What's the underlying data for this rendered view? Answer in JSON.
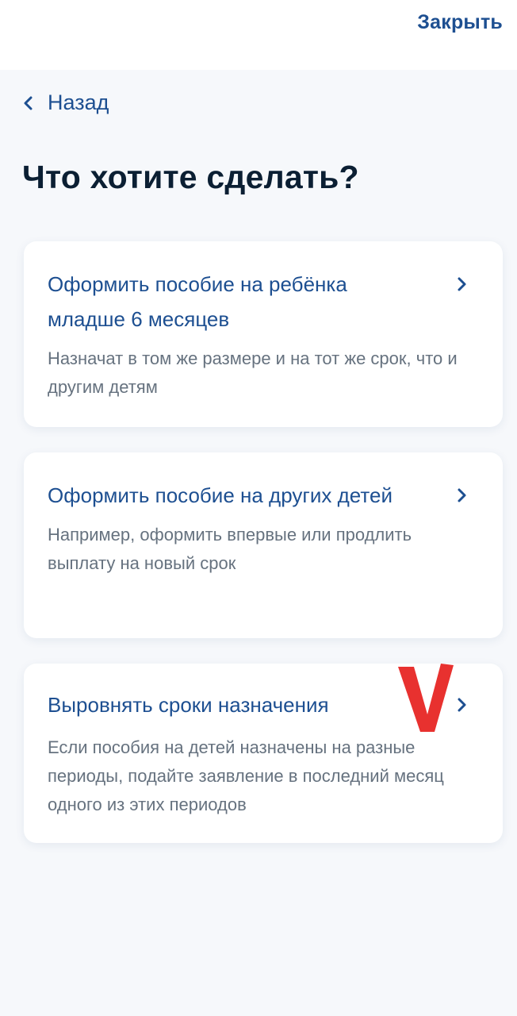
{
  "header": {
    "close_label": "Закрыть"
  },
  "nav": {
    "back_label": "Назад"
  },
  "page": {
    "title": "Что хотите сделать?"
  },
  "options": [
    {
      "title": "Оформить пособие на ребёнка младше 6 месяцев",
      "description": "Назначат в том же размере и на тот же срок, что и другим детям"
    },
    {
      "title": "Оформить пособие на других детей",
      "description": "Например, оформить впервые или продлить выплату на новый срок"
    },
    {
      "title": "Выровнять сроки назначения",
      "description": "Если пособия на детей назначены на разные периоды, подайте заявление в последний месяц одного из этих периодов"
    }
  ],
  "colors": {
    "accent": "#1d4f91",
    "heading": "#0b1f33",
    "muted": "#66727f",
    "background": "#f6f8fb",
    "annotation": "#e8312f"
  },
  "icons": {
    "back": "chevron-left-icon",
    "option": "chevron-right-icon",
    "annotation": "checkmark-v-icon"
  }
}
